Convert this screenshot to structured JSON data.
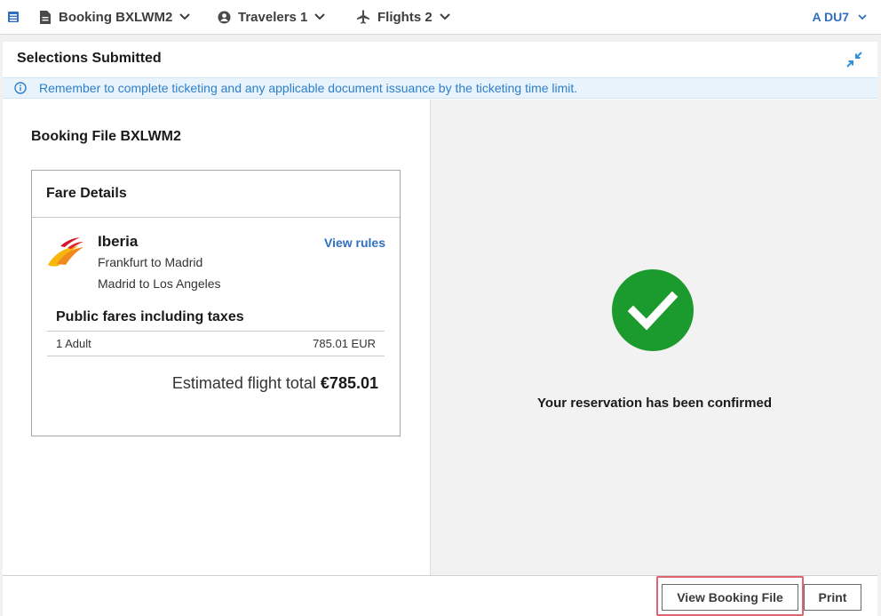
{
  "topbar": {
    "booking_label": "Booking BXLWM2",
    "travelers_label": "Travelers 1",
    "flights_label": "Flights 2",
    "agent_label": "A DU7"
  },
  "panel": {
    "title": "Selections Submitted",
    "info_banner": "Remember to complete ticketing and any applicable document issuance by the ticketing time limit."
  },
  "booking_file": {
    "title": "Booking File BXLWM2",
    "fare_card": {
      "heading": "Fare Details",
      "airline": "Iberia",
      "view_rules_label": "View rules",
      "routes": [
        "Frankfurt to Madrid",
        "Madrid to Los Angeles"
      ],
      "fares_heading": "Public fares including taxes",
      "fare_line": {
        "passenger": "1 Adult",
        "amount": "785.01 EUR"
      },
      "estimated_label": "Estimated flight total",
      "estimated_value": "€785.01"
    }
  },
  "confirmation": {
    "message": "Your reservation has been confirmed"
  },
  "footer": {
    "view_booking_label": "View Booking File",
    "print_label": "Print"
  },
  "colors": {
    "accent": "#2f6fc0",
    "success": "#1b9a2d",
    "highlight": "#e06470",
    "banner_bg": "#e9f3fb"
  },
  "icons": {
    "menu": "booking-menu-icon",
    "document": "document-icon",
    "person": "person-icon",
    "plane": "plane-icon",
    "chevron": "chevron-down-icon",
    "info": "info-icon",
    "collapse": "collapse-icon",
    "check": "check-circle-icon"
  }
}
